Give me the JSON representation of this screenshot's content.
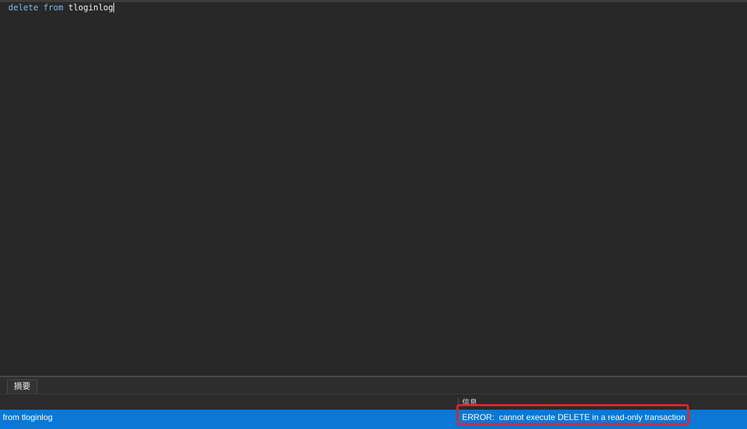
{
  "editor": {
    "keyword_delete": "delete",
    "keyword_from": "from",
    "table_name": "tloginlog"
  },
  "results": {
    "tabs": [
      {
        "label": "摘要"
      }
    ],
    "columns": [
      {
        "label": "信息"
      }
    ]
  },
  "status_bar": {
    "query_text": "from tloginlog",
    "message": "ERROR:  cannot execute DELETE in a read-only transaction"
  },
  "colors": {
    "background": "#282828",
    "keyword": "#7fb8e6",
    "status_bar": "#0a78d4",
    "highlight": "#e3242b"
  }
}
